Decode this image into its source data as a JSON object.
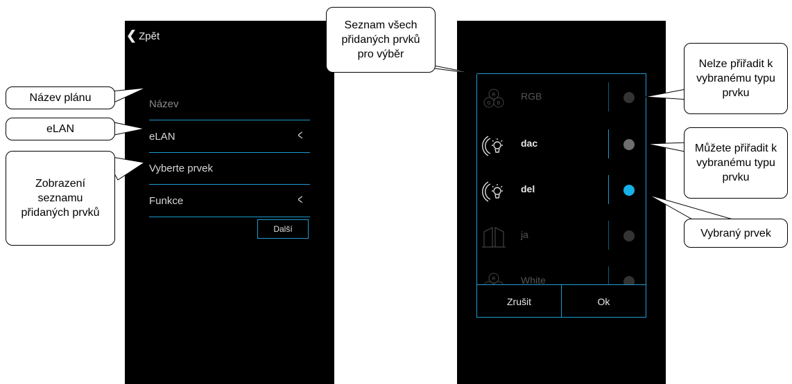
{
  "left_screen": {
    "back_label": "Zpět",
    "fields": [
      {
        "label": "Název",
        "placeholder": true,
        "arrow": false
      },
      {
        "label": "eLAN",
        "placeholder": false,
        "arrow": true
      },
      {
        "label": "Vyberte prvek",
        "placeholder": false,
        "arrow": false
      },
      {
        "label": "Funkce",
        "placeholder": false,
        "arrow": true
      }
    ],
    "next_label": "Další"
  },
  "dialog": {
    "items": [
      {
        "name": "RGB",
        "icon": "rgb-icon",
        "state": "disabled"
      },
      {
        "name": "dac",
        "icon": "dimmer-bulb-icon",
        "state": "available"
      },
      {
        "name": "del",
        "icon": "dimmer-bulb-icon",
        "state": "selected"
      },
      {
        "name": "ja",
        "icon": "blinds-icon",
        "state": "disabled"
      },
      {
        "name": "White",
        "icon": "rgb-icon",
        "state": "disabled"
      }
    ],
    "cancel_label": "Zrušit",
    "ok_label": "Ok"
  },
  "callouts": {
    "plan_name": "Název plánu",
    "elan": "eLAN",
    "element_list": "Zobrazení seznamu přidaných prvků",
    "all_added": "Seznam všech přidaných prvků pro výběr",
    "cannot_assign": "Nelze přiřadit k vybranému typu prvku",
    "can_assign": "Můžete přiřadit k vybranému typu prvku",
    "selected": "Vybraný prvek"
  },
  "colors": {
    "accent": "#1f9ed1",
    "selected_dot": "#17b1e8"
  }
}
